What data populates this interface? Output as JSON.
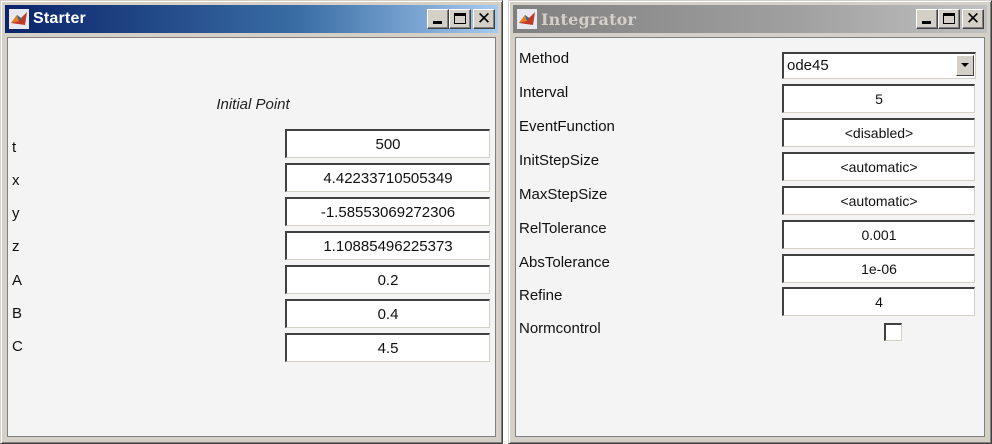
{
  "starter": {
    "title": "Starter",
    "heading": "Initial Point",
    "rows": [
      {
        "label": "t",
        "value": "500"
      },
      {
        "label": "x",
        "value": "4.42233710505349"
      },
      {
        "label": "y",
        "value": "-1.58553069272306"
      },
      {
        "label": "z",
        "value": "1.10885496225373"
      },
      {
        "label": "A",
        "value": "0.2"
      },
      {
        "label": "B",
        "value": "0.4"
      },
      {
        "label": "C",
        "value": "4.5"
      }
    ]
  },
  "integrator": {
    "title": "Integrator",
    "method": {
      "label": "Method",
      "value": "ode45"
    },
    "rows": [
      {
        "label": "Interval",
        "value": "5"
      },
      {
        "label": "EventFunction",
        "value": "<disabled>"
      },
      {
        "label": "InitStepSize",
        "value": "<automatic>"
      },
      {
        "label": "MaxStepSize",
        "value": "<automatic>"
      },
      {
        "label": "RelTolerance",
        "value": "0.001"
      },
      {
        "label": "AbsTolerance",
        "value": "1e-06"
      },
      {
        "label": "Refine",
        "value": "4"
      }
    ],
    "normcontrol": {
      "label": "Normcontrol",
      "checked": false
    }
  },
  "window_buttons": {
    "minimize": "minimize-icon",
    "maximize": "maximize-icon",
    "close": "close-icon"
  },
  "colors": {
    "active_title": "#0a246a",
    "inactive_title": "#808080",
    "face": "#d4d0c8"
  }
}
